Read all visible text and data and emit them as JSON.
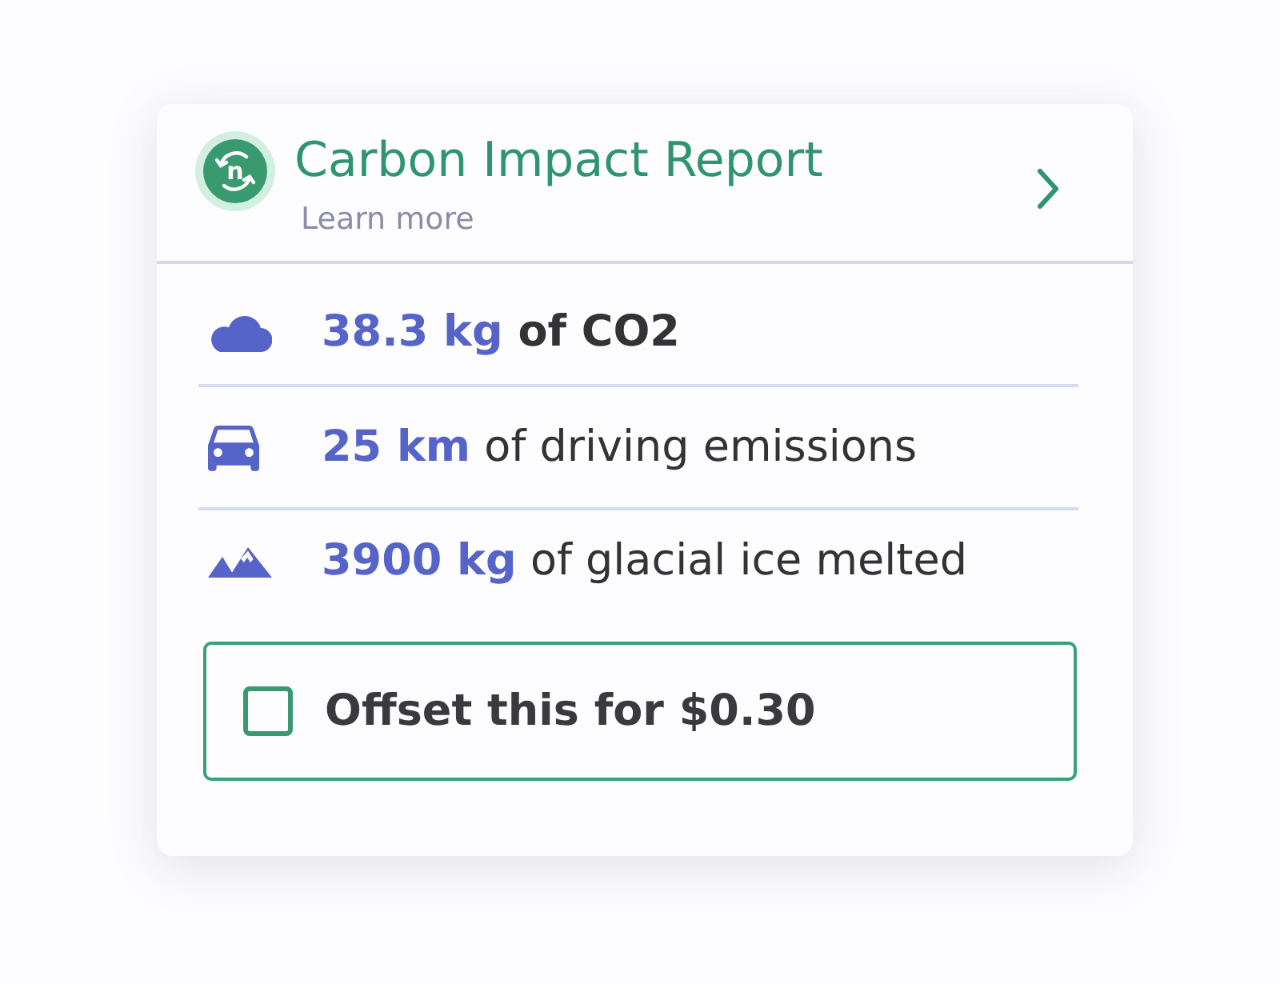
{
  "header": {
    "logo_letter": "n",
    "title": "Carbon Impact Report",
    "link": "Learn more"
  },
  "stats": [
    {
      "kind": "cloud",
      "value": "38.3 kg",
      "text": "of CO2",
      "bold": true
    },
    {
      "kind": "car",
      "value": "25 km",
      "text": "of driving emissions",
      "bold": false
    },
    {
      "kind": "mountains",
      "value": "3900 kg",
      "text": "of glacial ice melted",
      "bold": false
    }
  ],
  "offset": {
    "label": "Offset this for $0.30",
    "checked": false
  }
}
